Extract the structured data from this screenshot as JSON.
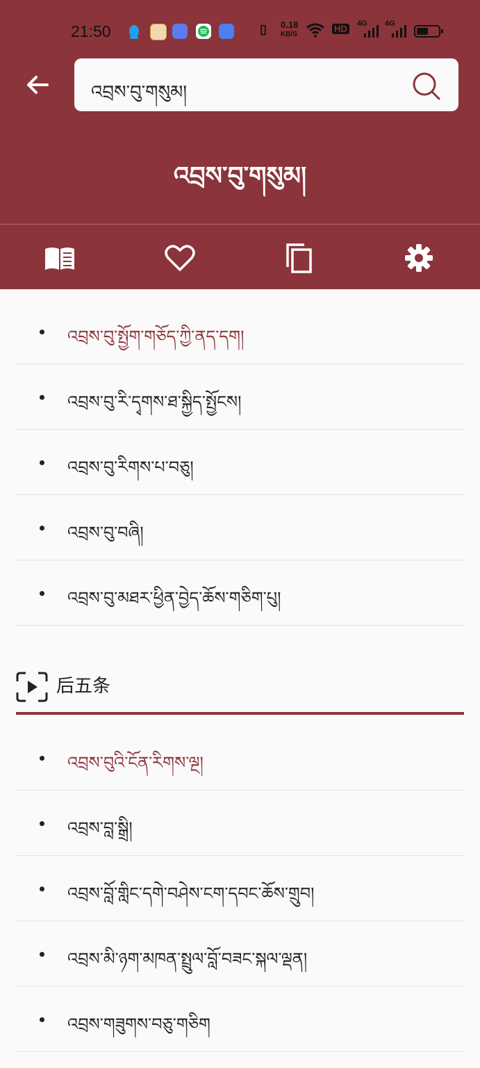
{
  "status_bar": {
    "time": "21:50",
    "net_speed": "0.18",
    "net_unit": "KB/S",
    "signal_1": "4G",
    "signal_2": "4G",
    "hd_badge": "HD"
  },
  "header": {
    "search_value": "འབྲས་བུ་གསུམ།",
    "title": "འབྲས་བུ་གསུམ།"
  },
  "toolbar": {
    "icons": [
      "book-icon",
      "heart-icon",
      "copy-icon",
      "gear-icon"
    ]
  },
  "list_top": [
    {
      "text": "འབྲས་བུ་སྤྱོག་གཅོད་ཀྱི་ནད་དག།",
      "active": true
    },
    {
      "text": "འབྲས་བུ་རི་དྭགས་ཐ་སྐྱིད་སྤྱོངས།",
      "active": false
    },
    {
      "text": "འབྲས་བུ་རིགས་པ་བཅུ།",
      "active": false
    },
    {
      "text": "འབྲས་བུ་བཞི།",
      "active": false
    },
    {
      "text": "འབྲས་བུ་མཐར་ཕྱིན་བྱེད་ཆོས་གཅིག་པུ།",
      "active": false
    }
  ],
  "section": {
    "label": "后五条",
    "icon": "play-frame-icon"
  },
  "list_bottom": [
    {
      "text": "འབྲས་བུའི་ངོན་རིགས་ལྔ།",
      "active": true
    },
    {
      "text": "འབྲས་བླ་སྒྲི།",
      "active": false
    },
    {
      "text": "འབྲས་བློ་གླིང་དགེ་བཤེས་ངག་དབང་ཆོས་གྲུབ།",
      "active": false
    },
    {
      "text": "འབྲས་མི་ཉག་མཁན་སྤྲུལ་བློ་བཟང་སྐལ་ལྡན།",
      "active": false
    },
    {
      "text": "འབྲས་གཟུགས་བཅུ་གཅིག",
      "active": false
    }
  ],
  "colors": {
    "brand": "#8b343b",
    "background": "#fafafa"
  }
}
